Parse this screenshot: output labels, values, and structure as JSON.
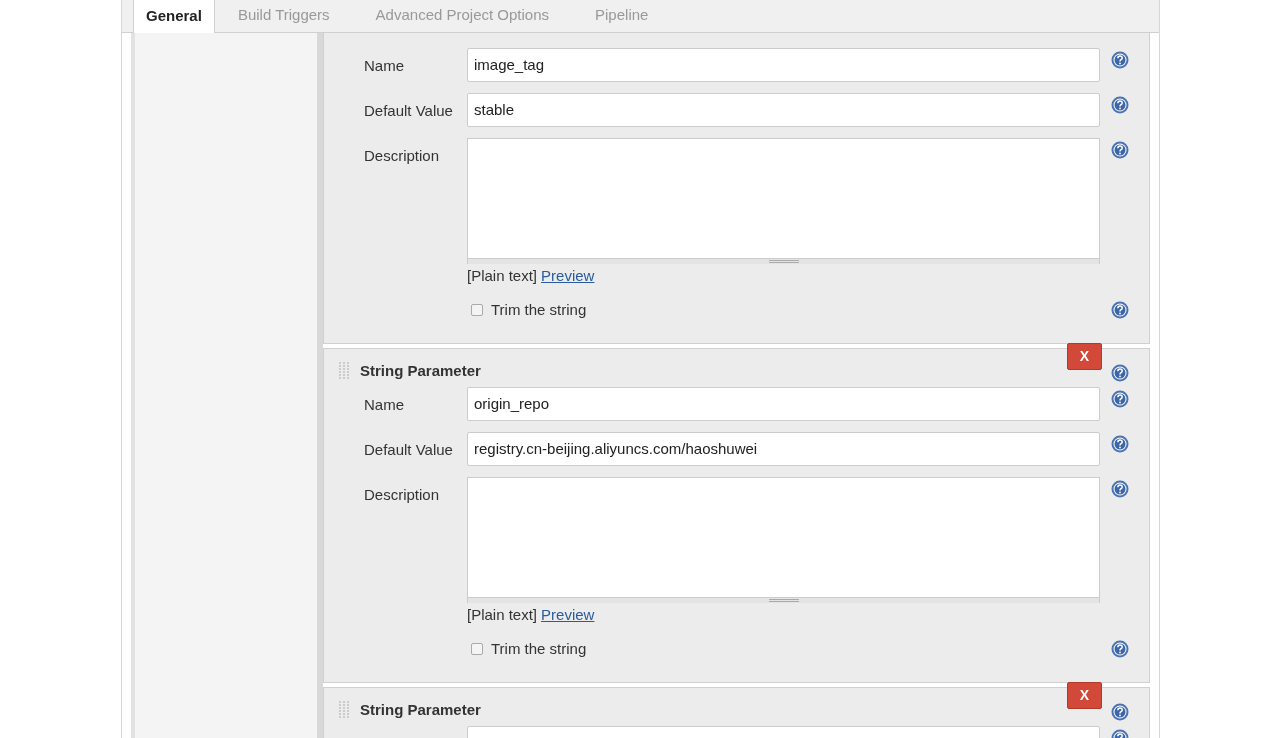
{
  "tabs": [
    {
      "label": "General",
      "selected": true
    },
    {
      "label": "Build Triggers",
      "selected": false
    },
    {
      "label": "Advanced Project Options",
      "selected": false
    },
    {
      "label": "Pipeline",
      "selected": false
    }
  ],
  "parameters": [
    {
      "fields": [
        {
          "kind": "text",
          "label": "Name",
          "value": "image_tag"
        },
        {
          "kind": "text",
          "label": "Default Value",
          "value": "stable"
        },
        {
          "kind": "textarea",
          "label": "Description"
        }
      ],
      "format": "[Plain text]",
      "preview_link": "Preview",
      "trim": {
        "label": "Trim the string",
        "checked": false
      }
    },
    {
      "title": "String Parameter",
      "delete": "X",
      "fields": [
        {
          "kind": "text",
          "label": "Name",
          "value": "origin_repo"
        },
        {
          "kind": "text",
          "label": "Default Value",
          "value": "registry.cn-beijing.aliyuncs.com/haoshuwei"
        },
        {
          "kind": "textarea",
          "label": "Description"
        }
      ],
      "format": "[Plain text]",
      "preview_link": "Preview",
      "trim": {
        "label": "Trim the string",
        "checked": false
      }
    },
    {
      "title": "String Parameter",
      "delete": "X",
      "fields": [
        {
          "kind": "text"
        }
      ]
    }
  ]
}
